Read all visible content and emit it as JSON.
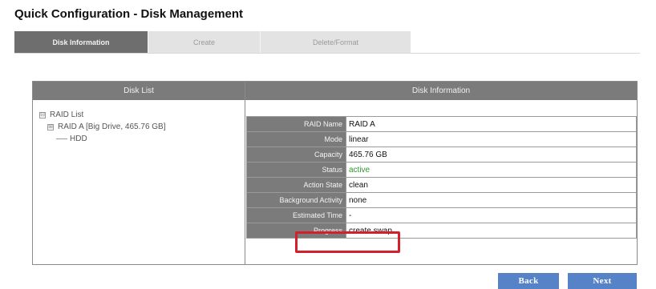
{
  "header": {
    "title": "Quick Configuration - Disk Management"
  },
  "tabs": [
    {
      "label": "Disk Information",
      "active": true
    },
    {
      "label": "Create",
      "active": false
    },
    {
      "label": "Delete/Format",
      "active": false
    }
  ],
  "disk_list": {
    "heading": "Disk List",
    "tree": {
      "root": {
        "label": "RAID List",
        "toggle": "⊟"
      },
      "raid": {
        "label": "RAID A [Big Drive, 465.76 GB]",
        "toggle": "⊞"
      },
      "leaf": {
        "label": "HDD"
      }
    }
  },
  "disk_info": {
    "heading": "Disk Information",
    "rows": [
      {
        "label": "RAID Name",
        "value": "RAID A"
      },
      {
        "label": "Mode",
        "value": "linear"
      },
      {
        "label": "Capacity",
        "value": "465.76 GB"
      },
      {
        "label": "Status",
        "value": "active"
      },
      {
        "label": "Action State",
        "value": "clean"
      },
      {
        "label": "Background Activity",
        "value": "none"
      },
      {
        "label": "Estimated Time",
        "value": "-"
      },
      {
        "label": "Progress",
        "value": "create swap"
      }
    ]
  },
  "footer": {
    "back_label": "Back",
    "next_label": "Next"
  },
  "colors": {
    "header_gray": "#7b7b7b",
    "button_blue": "#5683c7",
    "highlight_red": "#d3202a",
    "status_green": "#2f9a2f"
  }
}
